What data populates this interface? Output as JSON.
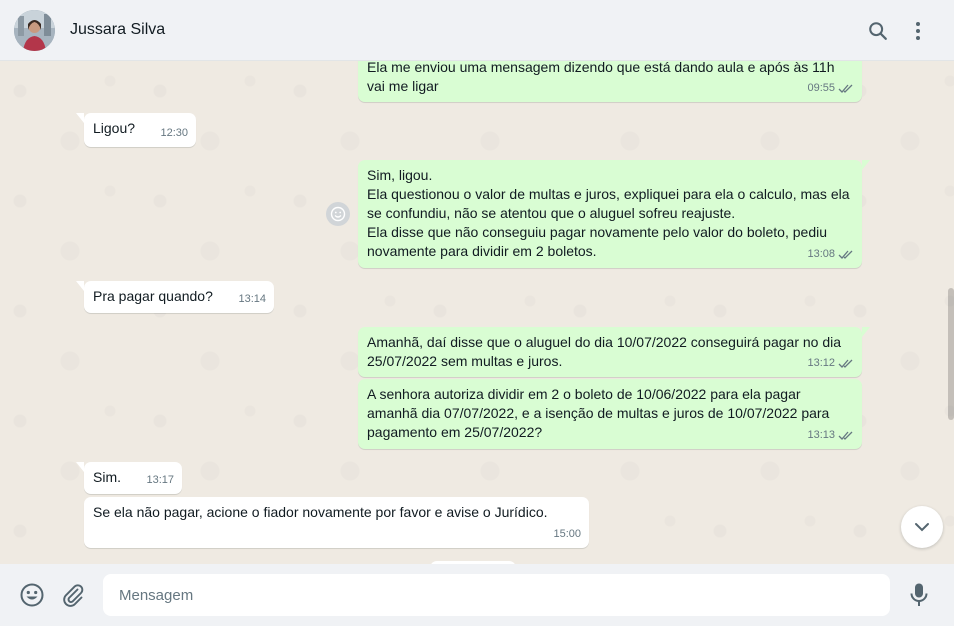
{
  "header": {
    "contact_name": "Jussara Silva",
    "icons": [
      "avatar",
      "search-icon",
      "menu-icon"
    ]
  },
  "messages": [
    {
      "direction": "out",
      "text": "Ela me enviou uma mensagem dizendo que está dando aula e após às 11h vai me ligar",
      "time": "09:55",
      "status": "read"
    },
    {
      "direction": "in",
      "text": "Ligou?",
      "time": "12:30"
    },
    {
      "direction": "out",
      "text": "Sim, ligou.\nEla questionou o valor de multas e juros, expliquei para ela o calculo, mas ela se confundiu, não se atentou que o aluguel sofreu reajuste.\nEla disse que não conseguiu pagar novamente pelo valor do boleto, pediu novamente para dividir em 2 boletos.",
      "time": "13:08",
      "status": "read"
    },
    {
      "direction": "in",
      "text": "Pra pagar quando?",
      "time": "13:14"
    },
    {
      "direction": "out",
      "text": "Amanhã, daí disse que o aluguel do dia 10/07/2022 conseguirá pagar no dia 25/07/2022 sem multas e juros.",
      "time": "13:12",
      "status": "read"
    },
    {
      "direction": "out",
      "text": "A senhora autoriza dividir em 2 o boleto de 10/06/2022 para ela pagar amanhã dia 07/07/2022, e a isenção de multas e juros de 10/07/2022 para pagamento em 25/07/2022?",
      "time": "13:13",
      "status": "read"
    },
    {
      "direction": "in",
      "text": "Sim.",
      "time": "13:17"
    },
    {
      "direction": "in",
      "text": "Se ela não pagar, acione o fiador novamente por favor e avise o Jurídico.",
      "time": "15:00"
    }
  ],
  "footer": {
    "placeholder": "Mensagem",
    "value": ""
  },
  "colors": {
    "outgoing_bubble": "#d9fdd3",
    "incoming_bubble": "#ffffff",
    "chat_background": "#efeae2",
    "header_background": "#f0f2f5",
    "read_ticks": "#667781"
  }
}
